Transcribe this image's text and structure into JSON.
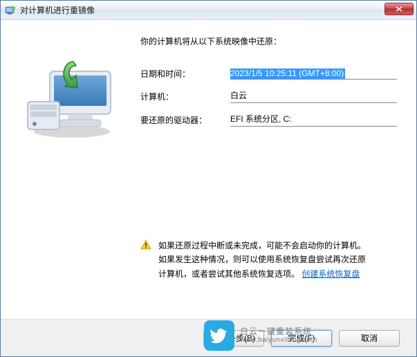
{
  "window": {
    "title": "对计算机进行重镜像"
  },
  "intro": "你的计算机将从以下系统映像中还原：",
  "info": {
    "datetime_label": "日期和时间：",
    "datetime_value": "2023/1/5 10:25:11 (GMT+8:00)",
    "computer_label": "计算机：",
    "computer_value": "白云",
    "drives_label": "要还原的驱动器：",
    "drives_value": "EFI 系统分区, C:"
  },
  "warning": {
    "line1": "如果还原过程中断或未完成，可能不会启动你的计算机。",
    "line2_a": "如果发生这种情况，则可以使用系统恢复盘尝试再次还原",
    "line2_b": "计算机，或者尝试其他系统恢复选项。",
    "link": "创建系统恢复盘"
  },
  "buttons": {
    "back": "< 上一步(B)",
    "finish": "完成(F)",
    "cancel": "取消"
  },
  "watermark": {
    "line1": "白云一键重装系统",
    "line2": "www.baiyunxitong.com"
  }
}
